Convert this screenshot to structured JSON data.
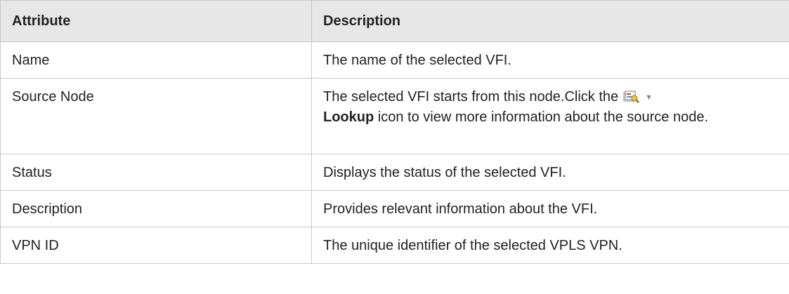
{
  "table": {
    "headers": {
      "attribute": "Attribute",
      "description": "Description"
    },
    "rows": [
      {
        "attribute": "Name",
        "description": "The name of the selected VFI."
      },
      {
        "attribute": "Source Node",
        "description_before": "The selected VFI starts from this node.Click the",
        "lookup_label": "Lookup",
        "description_after": " icon to view more information about the source node.",
        "icon": "lookup-icon"
      },
      {
        "attribute": "Status",
        "description": "Displays the status of the selected VFI."
      },
      {
        "attribute": "Description",
        "description": "Provides relevant information about the VFI."
      },
      {
        "attribute": "VPN ID",
        "description": "The unique identifier of the selected VPLS VPN."
      }
    ]
  },
  "colors": {
    "header_background": "#e7e7e7",
    "border": "#c8c8c8",
    "text": "#222222"
  }
}
